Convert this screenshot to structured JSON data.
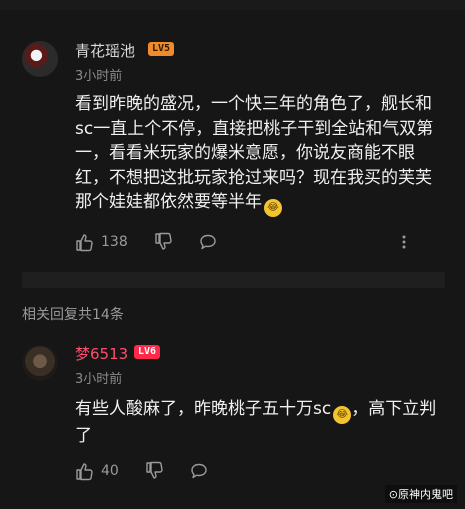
{
  "comments": [
    {
      "username": "青花瑶池",
      "level": "LV5",
      "time": "3小时前",
      "text": "看到昨晚的盛况，一个快三年的角色了，舰长和sc一直上个不停，直接把桃子干到全站和气双第一，看看米玩家的爆米意愿，你说友商能不眼红，不想把这批玩家抢过来吗？现在我买的芙芙那个娃娃都依然要等半年",
      "emoji": "crying-laughing-emoji",
      "likes": "138"
    },
    {
      "username": "梦6513",
      "level": "LV6",
      "time": "3小时前",
      "text_before_emoji": "有些人酸麻了，昨晚桃子五十万sc",
      "emoji": "crying-laughing-emoji",
      "text_after_emoji": "，高下立判了",
      "likes": "40"
    }
  ],
  "replies_summary": "相关回复共14条",
  "watermark": "⊙原神内鬼吧",
  "colors": {
    "background": "#161616",
    "username_default": "#d8d8d8",
    "username_vip": "#ff4d6d",
    "lv5_badge": "#f08a2a",
    "lv6_badge": "#ff2a4a",
    "secondary_text": "#8a8a8a"
  }
}
